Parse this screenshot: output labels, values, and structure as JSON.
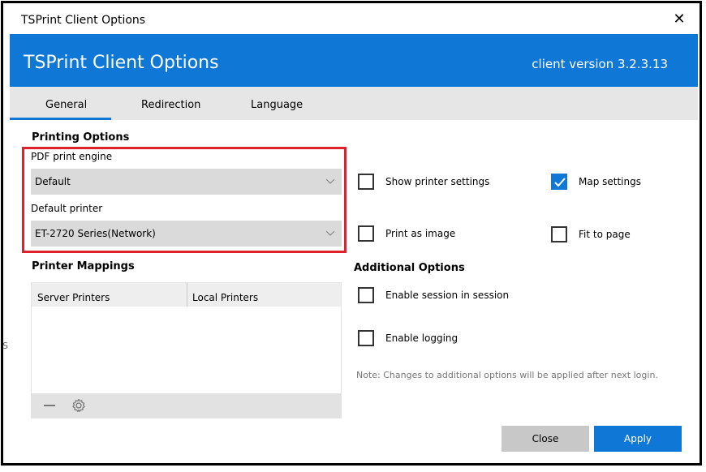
{
  "window": {
    "title": "TSPrint Client Options",
    "close_glyph": "✕"
  },
  "banner": {
    "title": "TSPrint Client Options",
    "version": "client version 3.2.3.13",
    "color": "#0f78d6"
  },
  "tabs": [
    {
      "label": "General",
      "selected": true
    },
    {
      "label": "Redirection",
      "selected": false
    },
    {
      "label": "Language",
      "selected": false
    }
  ],
  "printing_options": {
    "title": "Printing Options",
    "pdf_engine_label": "PDF print engine",
    "pdf_engine_value": "Default",
    "default_printer_label": "Default printer",
    "default_printer_value": "ET-2720 Series(Network)"
  },
  "checkboxes": {
    "show_printer_settings": {
      "label": "Show printer settings",
      "checked": false
    },
    "map_settings": {
      "label": "Map settings",
      "checked": true
    },
    "print_as_image": {
      "label": "Print as image",
      "checked": false
    },
    "fit_to_page": {
      "label": "Fit to page",
      "checked": false
    }
  },
  "additional_options": {
    "title": "Additional Options",
    "enable_session_in_session": {
      "label": "Enable session in session",
      "checked": false
    },
    "enable_logging": {
      "label": "Enable logging",
      "checked": false
    },
    "note": "Note: Changes to additional options will be applied after next login."
  },
  "printer_mappings": {
    "title": "Printer Mappings",
    "columns": [
      "Server Printers",
      "Local Printers"
    ],
    "rows": [],
    "footer_icons": [
      "minus-icon",
      "gear-icon"
    ]
  },
  "buttons": {
    "close": "Close",
    "apply": "Apply"
  },
  "stray_text": "S"
}
